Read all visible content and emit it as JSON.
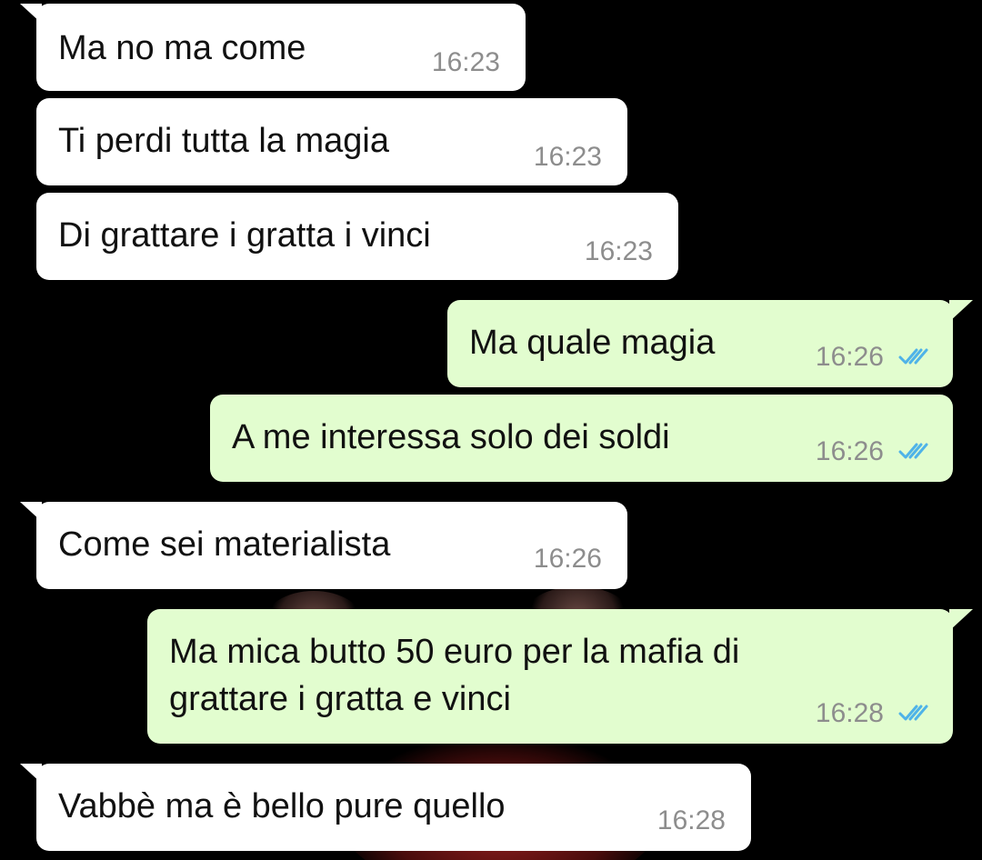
{
  "conversation": {
    "messages": [
      {
        "direction": "in",
        "text": "Ma no ma come",
        "time": "16:23"
      },
      {
        "direction": "in",
        "text": "Ti perdi tutta la magia",
        "time": "16:23"
      },
      {
        "direction": "in",
        "text": "Di grattare i gratta i vinci",
        "time": "16:23"
      },
      {
        "direction": "out",
        "text": "Ma quale magia",
        "time": "16:26",
        "status": "read",
        "status_icon": "double-check-icon"
      },
      {
        "direction": "out",
        "text": "A me interessa solo dei soldi",
        "time": "16:26",
        "status": "read",
        "status_icon": "double-check-icon"
      },
      {
        "direction": "in",
        "text": "Come sei materialista",
        "time": "16:26"
      },
      {
        "direction": "out",
        "text_line1": "Ma mica butto 50 euro per la mafia di",
        "text_line2": "grattare i gratta e vinci",
        "time": "16:28",
        "status": "read",
        "status_icon": "double-check-icon"
      },
      {
        "direction": "in",
        "text": "Vabbè ma è bello pure quello",
        "time": "16:28"
      }
    ]
  },
  "colors": {
    "background": "#000000",
    "incoming_bubble": "#ffffff",
    "outgoing_bubble": "#e2fdcf",
    "timestamp": "#8d8d8d",
    "read_ticks": "#4fb3e8"
  }
}
